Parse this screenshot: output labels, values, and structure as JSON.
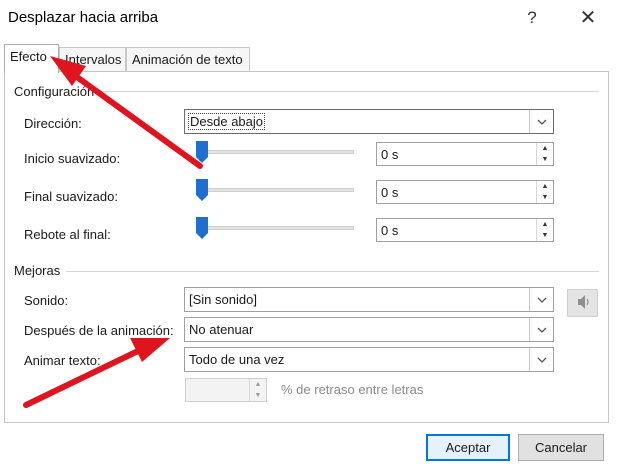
{
  "window": {
    "title": "Desplazar hacia arriba",
    "help_glyph": "?",
    "close_glyph": "✕"
  },
  "tabs": [
    {
      "label": "Efecto",
      "active": true
    },
    {
      "label": "Intervalos",
      "active": false
    },
    {
      "label": "Animación de texto",
      "active": false
    }
  ],
  "settings": {
    "section_label": "Configuración",
    "direction": {
      "label": "Dirección:",
      "value": "Desde abajo"
    },
    "smooth_start": {
      "label": "Inicio suavizado:",
      "value": "0 s",
      "level": 0
    },
    "smooth_end": {
      "label": "Final suavizado:",
      "value": "0 s",
      "level": 0
    },
    "bounce_end": {
      "label": "Rebote al final:",
      "value": "0 s",
      "level": 0
    }
  },
  "enhancements": {
    "section_label": "Mejoras",
    "sound": {
      "label": "Sonido:",
      "value": "[Sin sonido]"
    },
    "after_animation": {
      "label": "Después de la animación:",
      "value": "No atenuar"
    },
    "animate_text": {
      "label": "Animar texto:",
      "value": "Todo de una vez"
    },
    "delay": {
      "value": "",
      "suffix": "% de retraso entre letras"
    }
  },
  "buttons": {
    "ok": "Aceptar",
    "cancel": "Cancelar"
  },
  "icons": {
    "sound_preview": "speaker-icon",
    "dropdown": "chevron-down-icon",
    "spin_up": "caret-up-icon",
    "spin_down": "caret-down-icon"
  },
  "colors": {
    "accent": "#0078d7",
    "slider_thumb": "#1f6fd1",
    "annotation_arrow": "#e0141e"
  }
}
